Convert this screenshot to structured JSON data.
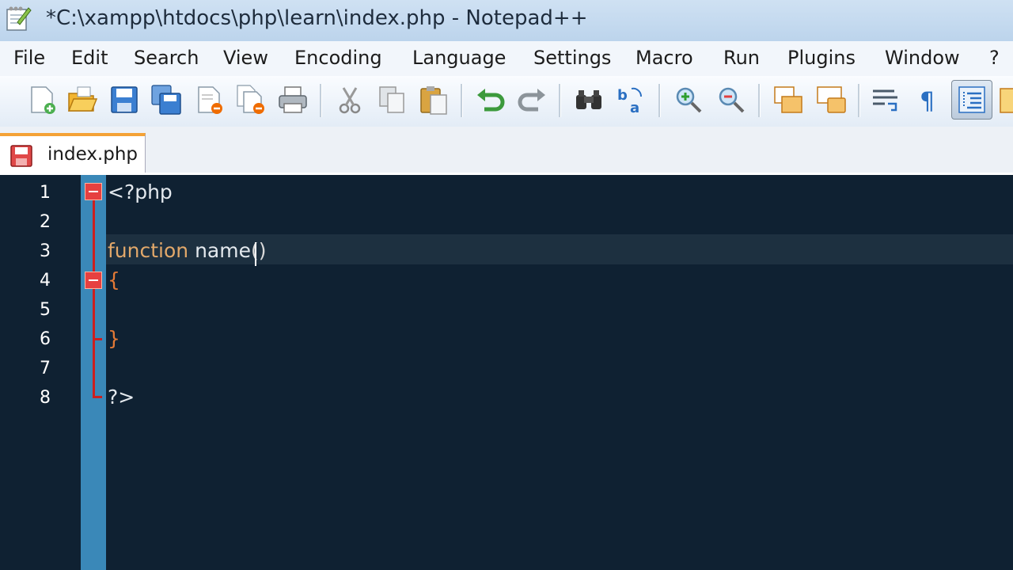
{
  "window": {
    "title": "*C:\\xampp\\htdocs\\php\\learn\\index.php - Notepad++"
  },
  "menu": [
    "File",
    "Edit",
    "Search",
    "View",
    "Encoding",
    "Language",
    "Settings",
    "Macro",
    "Run",
    "Plugins",
    "Window",
    "?"
  ],
  "toolbar": {
    "icons": [
      "new-file-icon",
      "open-file-icon",
      "save-icon",
      "save-all-icon",
      "close-icon",
      "close-all-icon",
      "print-icon",
      "cut-icon",
      "copy-icon",
      "paste-icon",
      "undo-icon",
      "redo-icon",
      "find-icon",
      "replace-icon",
      "zoom-in-icon",
      "zoom-out-icon",
      "sync-vertical-icon",
      "sync-horizontal-icon",
      "word-wrap-icon",
      "show-all-characters-icon",
      "indent-guide-icon"
    ]
  },
  "tabs": [
    {
      "label": "index.php",
      "active": true
    }
  ],
  "editor": {
    "line_numbers": [
      "1",
      "2",
      "3",
      "4",
      "5",
      "6",
      "7",
      "8"
    ],
    "lines": {
      "l1": "<?php",
      "l3_keyword": "function",
      "l3_name": " name",
      "l3_parens": "()",
      "l4": "{",
      "l6": "}",
      "l8": "?>"
    },
    "current_line": 3
  },
  "colors": {
    "background": "#0f2132",
    "fold_margin": "#3a88b8",
    "keyword": "#e2a86a",
    "brace": "#e47a36",
    "fold_marker": "#e64040"
  }
}
